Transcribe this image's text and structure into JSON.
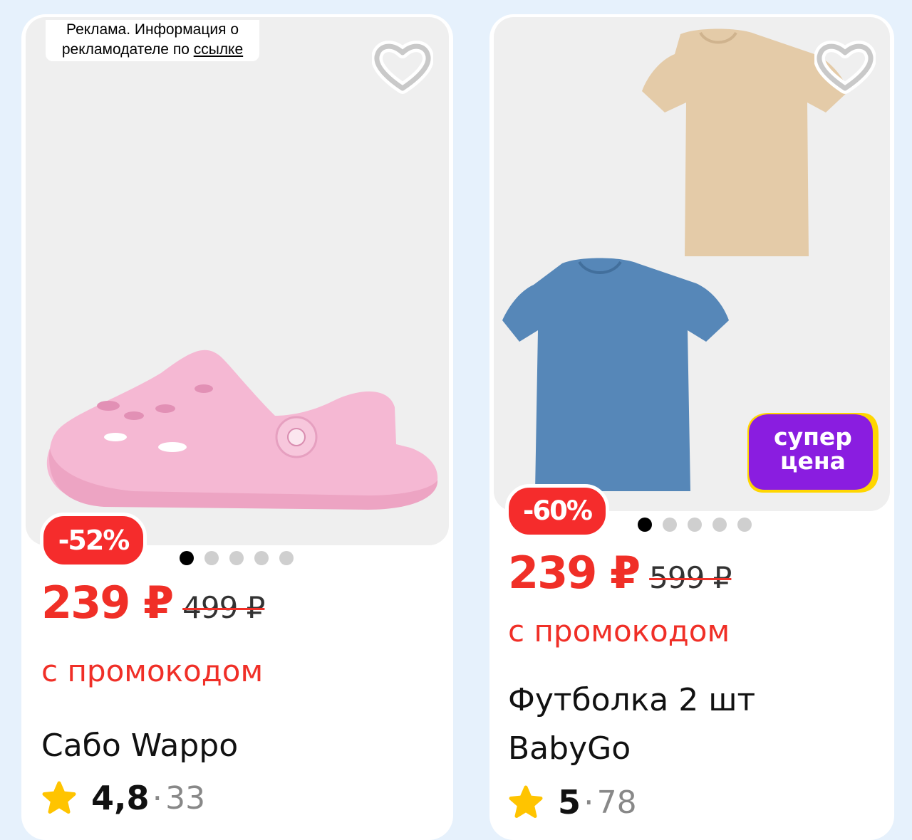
{
  "products": [
    {
      "ad_label": {
        "line1": "Реклама. Информация о",
        "line2_prefix": "рекламодателе по ",
        "link": "ссылке"
      },
      "image_name": "pink-clog-image",
      "discount": "-52%",
      "price": "239 ₽",
      "old_price": "499 ₽",
      "promo": "с промокодом",
      "title": "Сабо Wappo",
      "rating": "4,8",
      "separator": "·",
      "reviews": "33",
      "carousel": {
        "count": 5,
        "active": 1
      },
      "favorite_icon": "heart-outline-icon",
      "rating_icon": "star-icon"
    },
    {
      "image_name": "tshirts-image",
      "sticker": {
        "line1": "супер",
        "line2": "цена"
      },
      "discount": "-60%",
      "price": "239 ₽",
      "old_price": "599 ₽",
      "promo": "с промокодом",
      "title_line1": "Футболка 2 шт",
      "title_line2": "BabyGo",
      "rating": "5",
      "separator": "·",
      "reviews": "78",
      "carousel": {
        "count": 5,
        "active": 1
      },
      "favorite_icon": "heart-outline-icon",
      "rating_icon": "star-icon"
    }
  ],
  "colors": {
    "background": "#e6f1fc",
    "accent_red": "#f02f27",
    "sticker_purple": "#8a1de0",
    "sticker_yellow": "#ffd600",
    "star_yellow": "#ffc400"
  }
}
